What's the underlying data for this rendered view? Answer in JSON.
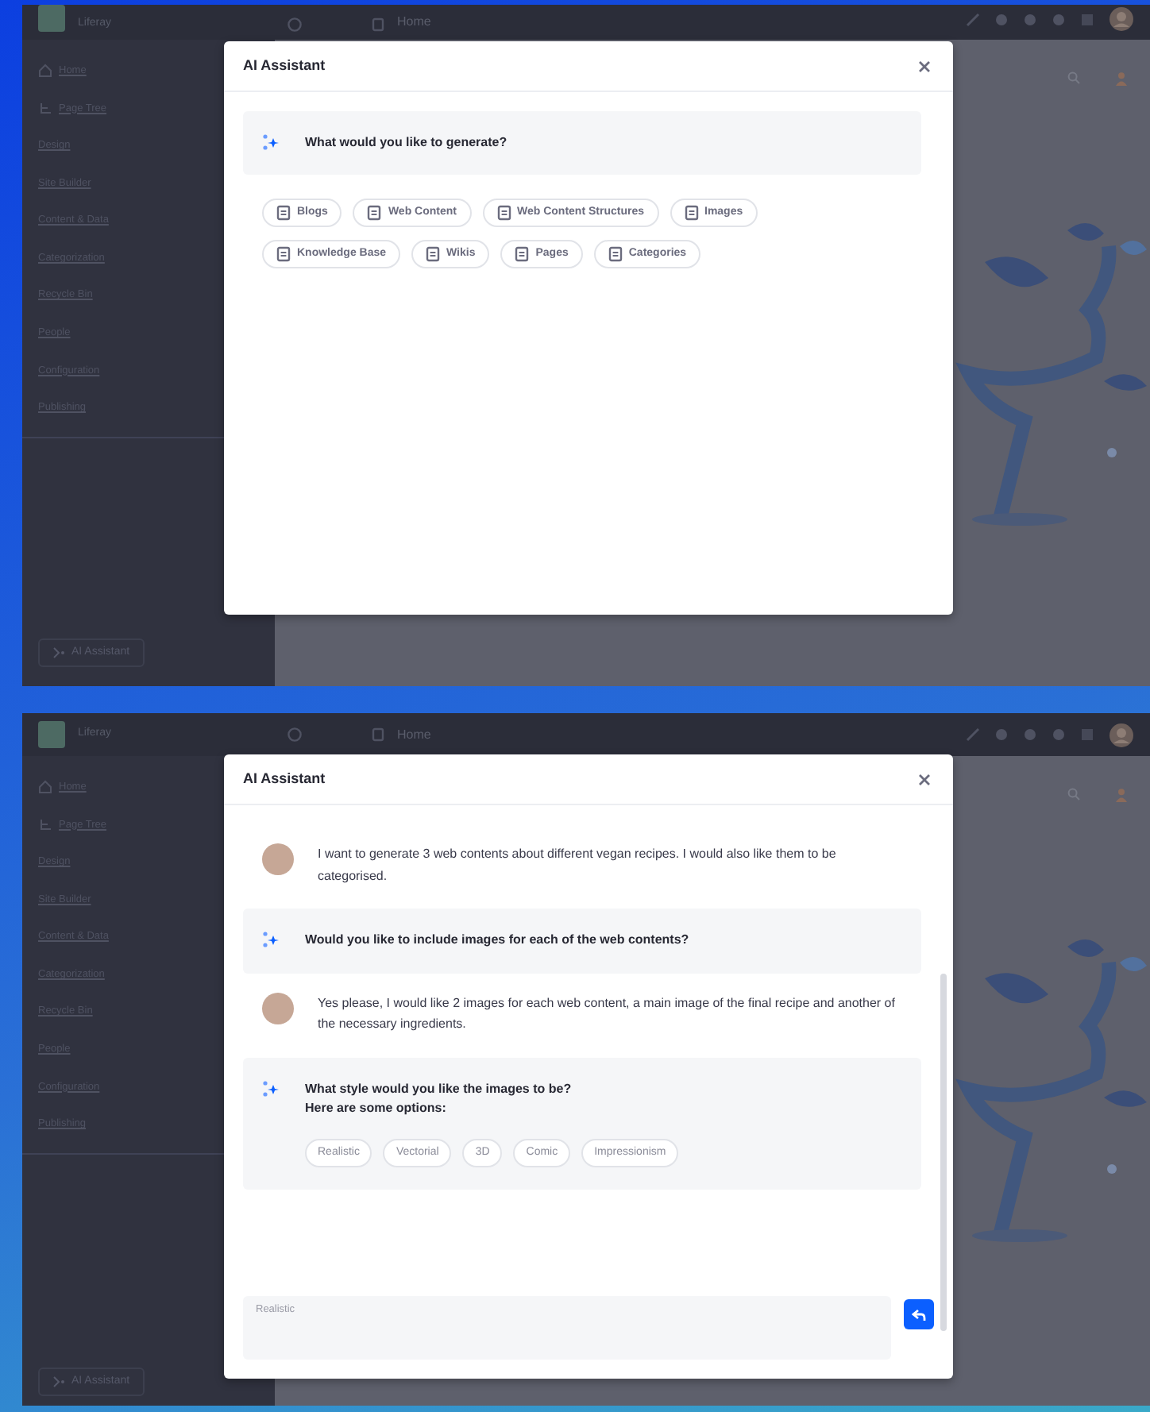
{
  "screens": [
    {
      "app": {
        "brand": "Liferay",
        "page": "Home",
        "nav": [
          {
            "label": "Home",
            "kind": "home"
          },
          {
            "label": "Page Tree",
            "kind": "tree"
          },
          {
            "label": "Design",
            "kind": "plain"
          },
          {
            "label": "Site Builder",
            "kind": "plain"
          },
          {
            "label": "Content & Data",
            "kind": "plain"
          },
          {
            "label": "Categorization",
            "kind": "plain"
          },
          {
            "label": "Recycle Bin",
            "kind": "plain"
          },
          {
            "label": "People",
            "kind": "plain"
          },
          {
            "label": "Configuration",
            "kind": "plain"
          },
          {
            "label": "Publishing",
            "kind": "plain"
          }
        ],
        "assistant_button": "AI Assistant"
      },
      "dialog": {
        "title": "AI Assistant",
        "messages": [
          {
            "kind": "ai",
            "text": "What would you like to generate?"
          }
        ],
        "content_types": [
          "Blogs",
          "Web Content",
          "Web Content Structures",
          "Images",
          "Knowledge Base",
          "Wikis",
          "Pages",
          "Categories"
        ]
      }
    },
    {
      "app": {
        "brand": "Liferay",
        "page": "Home",
        "nav": [
          {
            "label": "Home",
            "kind": "home"
          },
          {
            "label": "Page Tree",
            "kind": "tree"
          },
          {
            "label": "Design",
            "kind": "plain"
          },
          {
            "label": "Site Builder",
            "kind": "plain"
          },
          {
            "label": "Content & Data",
            "kind": "plain"
          },
          {
            "label": "Categorization",
            "kind": "plain"
          },
          {
            "label": "Recycle Bin",
            "kind": "plain"
          },
          {
            "label": "People",
            "kind": "plain"
          },
          {
            "label": "Configuration",
            "kind": "plain"
          },
          {
            "label": "Publishing",
            "kind": "plain"
          }
        ],
        "assistant_button": "AI Assistant"
      },
      "dialog": {
        "title": "AI Assistant",
        "messages": [
          {
            "kind": "user",
            "text": "I want to generate 3 web contents about different vegan recipes. I would also like them to be categorised."
          },
          {
            "kind": "ai",
            "text": "Would you like to include images for each of the web contents?"
          },
          {
            "kind": "user",
            "text": "Yes please, I would like 2 images for each web content, a main image of the final recipe and another of the necessary ingredients."
          },
          {
            "kind": "ai",
            "text": "What style would you like the images to be?",
            "follow_up": "Here are some options:",
            "options": [
              "Realistic",
              "Vectorial",
              "3D",
              "Comic",
              "Impressionism"
            ]
          }
        ],
        "composer": {
          "value": "Realistic"
        }
      }
    }
  ]
}
